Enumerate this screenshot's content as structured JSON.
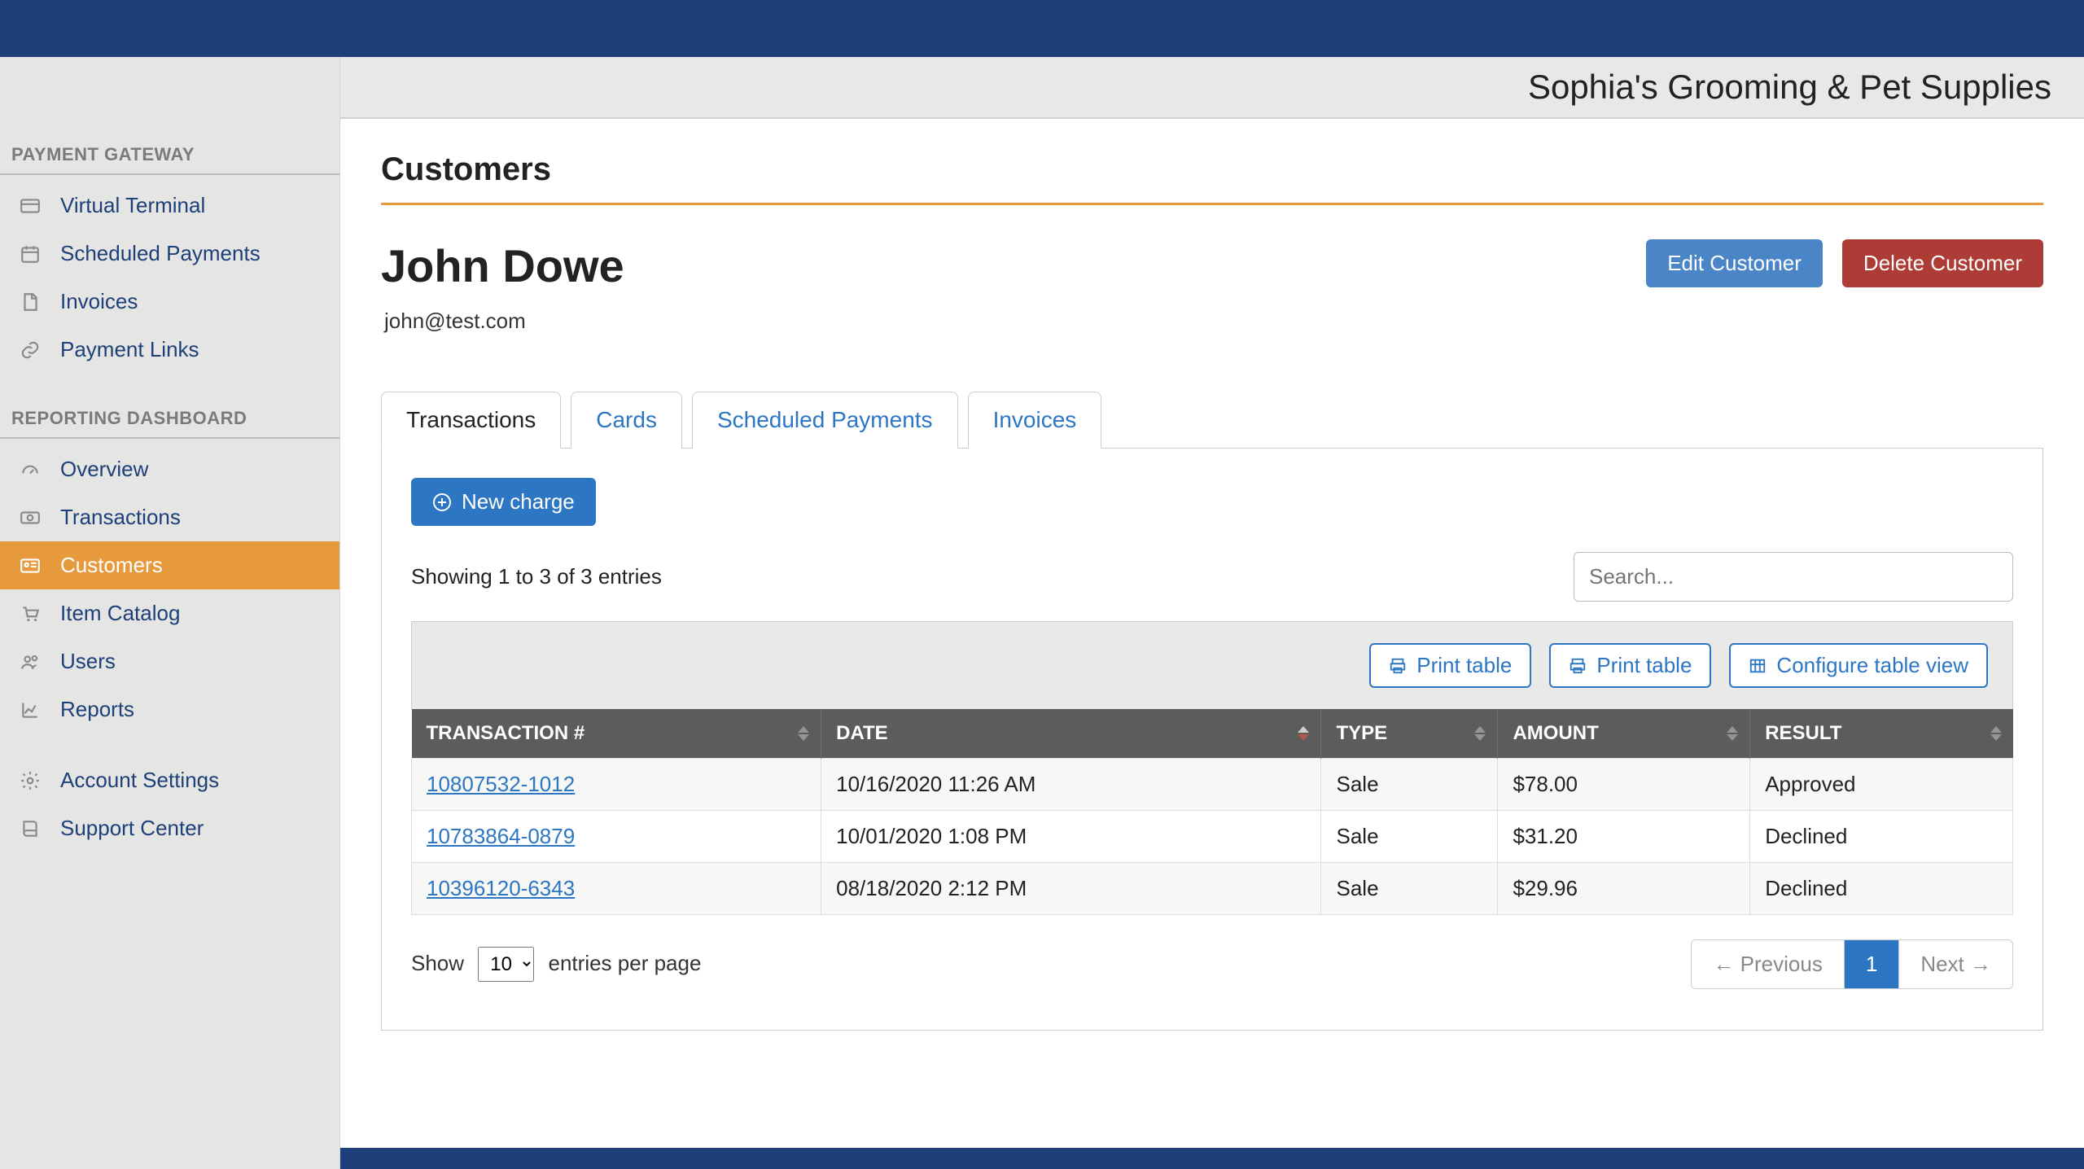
{
  "brand": "Sophia's Grooming & Pet Supplies",
  "sidebar": {
    "section1_title": "PAYMENT GATEWAY",
    "section2_title": "REPORTING DASHBOARD",
    "items1": [
      {
        "label": "Virtual Terminal",
        "icon": "card"
      },
      {
        "label": "Scheduled Payments",
        "icon": "calendar"
      },
      {
        "label": "Invoices",
        "icon": "file"
      },
      {
        "label": "Payment Links",
        "icon": "link"
      }
    ],
    "items2": [
      {
        "label": "Overview",
        "icon": "gauge"
      },
      {
        "label": "Transactions",
        "icon": "money"
      },
      {
        "label": "Customers",
        "icon": "id-card",
        "active": true
      },
      {
        "label": "Item Catalog",
        "icon": "cart"
      },
      {
        "label": "Users",
        "icon": "users"
      },
      {
        "label": "Reports",
        "icon": "chart"
      }
    ],
    "items3": [
      {
        "label": "Account Settings",
        "icon": "gear"
      },
      {
        "label": "Support Center",
        "icon": "book"
      }
    ]
  },
  "page": {
    "section_title": "Customers",
    "customer_name": "John Dowe",
    "customer_email": "john@test.com",
    "edit_label": "Edit Customer",
    "delete_label": "Delete Customer"
  },
  "tabs": [
    {
      "label": "Transactions",
      "active": true
    },
    {
      "label": "Cards"
    },
    {
      "label": "Scheduled Payments"
    },
    {
      "label": "Invoices"
    }
  ],
  "actions": {
    "new_charge": "New charge",
    "print_table": "Print table",
    "configure_view": "Configure table view"
  },
  "table": {
    "showing_text": "Showing 1 to 3 of 3 entries",
    "search_placeholder": "Search...",
    "columns": [
      "TRANSACTION #",
      "DATE",
      "TYPE",
      "AMOUNT",
      "RESULT"
    ],
    "sort_active_col": 1,
    "sort_dir": "desc",
    "rows": [
      {
        "id": "10807532-1012",
        "date": "10/16/2020 11:26 AM",
        "type": "Sale",
        "amount": "$78.00",
        "result": "Approved"
      },
      {
        "id": "10783864-0879",
        "date": "10/01/2020 1:08 PM",
        "type": "Sale",
        "amount": "$31.20",
        "result": "Declined"
      },
      {
        "id": "10396120-6343",
        "date": "08/18/2020 2:12 PM",
        "type": "Sale",
        "amount": "$29.96",
        "result": "Declined"
      }
    ]
  },
  "pagination": {
    "show_label": "Show",
    "per_page_label": "entries per page",
    "per_page_value": "10",
    "prev": "← Previous",
    "next": "Next →",
    "current_page": "1"
  }
}
